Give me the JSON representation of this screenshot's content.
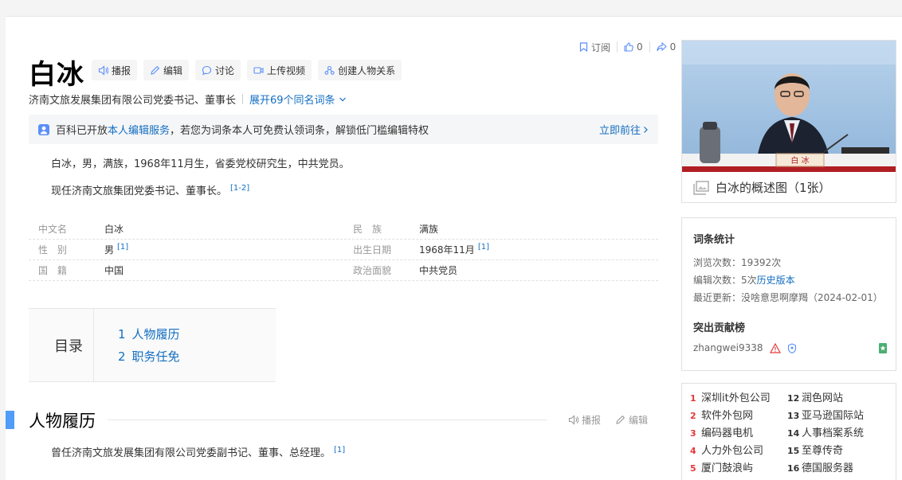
{
  "header": {
    "subscribe": "订阅",
    "like_count": "0",
    "share_count": "0"
  },
  "entry": {
    "title": "白冰",
    "buttons": [
      "播报",
      "编辑",
      "讨论",
      "上传视频",
      "创建人物关系"
    ],
    "subtitle": "济南文旅发展集团有限公司党委书记、董事长",
    "homonym_link": "展开69个同名词条"
  },
  "notice": {
    "prefix": "百科已开放",
    "link": "本人编辑服务",
    "suffix": "，若您为词条本人可免费认领词条，解锁低门槛编辑特权",
    "goto": "立即前往"
  },
  "summary": {
    "p1": "白冰，男，满族，1968年11月生，省委党校研究生，中共党员。",
    "p2": "现任济南文旅集团党委书记、董事长。",
    "p2_ref": "[1-2]"
  },
  "basic_info": [
    {
      "left_key": "中文名",
      "left_val": "白冰",
      "left_ref": "",
      "right_key": "民　族",
      "right_val": "满族",
      "right_ref": ""
    },
    {
      "left_key": "性　别",
      "left_val": "男",
      "left_ref": "[1]",
      "right_key": "出生日期",
      "right_val": "1968年11月",
      "right_ref": "[1]"
    },
    {
      "left_key": "国　籍",
      "left_val": "中国",
      "left_ref": "",
      "right_key": "政治面貌",
      "right_val": "中共党员",
      "right_ref": ""
    }
  ],
  "catalog": {
    "label": "目录",
    "items": [
      {
        "num": "1",
        "text": "人物履历"
      },
      {
        "num": "2",
        "text": "职务任免"
      }
    ]
  },
  "section": {
    "title": "人物履历",
    "broadcast": "播报",
    "edit": "编辑",
    "text": "曾任济南文旅发展集团有限公司党委副书记、董事、总经理。",
    "ref": "[1]"
  },
  "photo": {
    "caption": "白冰的概述图（1张）",
    "nameplate": "白 冰"
  },
  "stats": {
    "heading": "词条统计",
    "views_label": "浏览次数：",
    "views": "19392次",
    "edits_label": "编辑次数：",
    "edits": "5次",
    "history_link": "历史版本",
    "updated_label": "最近更新：",
    "updated_user": "没啥意思啊摩羯",
    "updated_date": "（2024-02-01）",
    "contrib_heading": "突出贡献榜",
    "contributor": "zhangwei9338"
  },
  "hot_list": [
    {
      "num": "1",
      "text": "深圳it外包公司"
    },
    {
      "num": "12",
      "text": "润色网站"
    },
    {
      "num": "2",
      "text": "软件外包网"
    },
    {
      "num": "13",
      "text": "亚马逊国际站"
    },
    {
      "num": "3",
      "text": "编码器电机"
    },
    {
      "num": "14",
      "text": "人事档案系统"
    },
    {
      "num": "4",
      "text": "人力外包公司"
    },
    {
      "num": "15",
      "text": "至尊传奇"
    },
    {
      "num": "5",
      "text": "厦门鼓浪屿"
    },
    {
      "num": "16",
      "text": "德国服务器"
    }
  ],
  "colors": {
    "link": "#136ec2",
    "accent_bar": "#4f9cf9",
    "hot_top": "#e4393c"
  }
}
